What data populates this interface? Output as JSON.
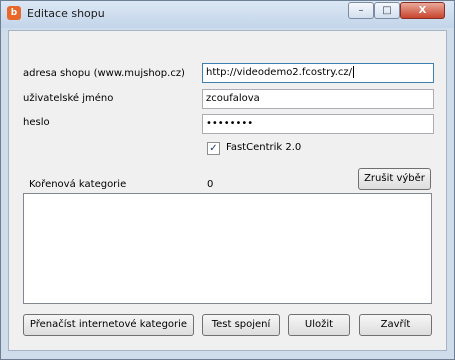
{
  "window": {
    "title": "Editace shopu",
    "app_icon_glyph": "b",
    "controls": {
      "minimize": "–",
      "maximize": "□",
      "close": "X"
    }
  },
  "form": {
    "shop_address_label": "adresa shopu (www.mujshop.cz)",
    "shop_address_value": "http://videodemo2.fcostry.cz/",
    "username_label": "uživatelské jméno",
    "username_value": "zcoufalova",
    "password_label": "heslo",
    "password_value": "••••••••",
    "fastcentrik_label": "FastCentrik 2.0",
    "fastcentrik_checked": true,
    "root_category_label": "Kořenová kategorie",
    "root_category_value": "0",
    "clear_selection_label": "Zrušit výběr"
  },
  "buttons": {
    "reload_categories": "Přenačíst internetové kategorie",
    "test_connection": "Test spojení",
    "save": "Uložit",
    "close": "Zavřít"
  },
  "colors": {
    "title_gradient_top": "#dbe7f4",
    "close_button": "#c8442e",
    "app_icon": "#e8672b",
    "dialog_background": "#f0f0f0"
  }
}
